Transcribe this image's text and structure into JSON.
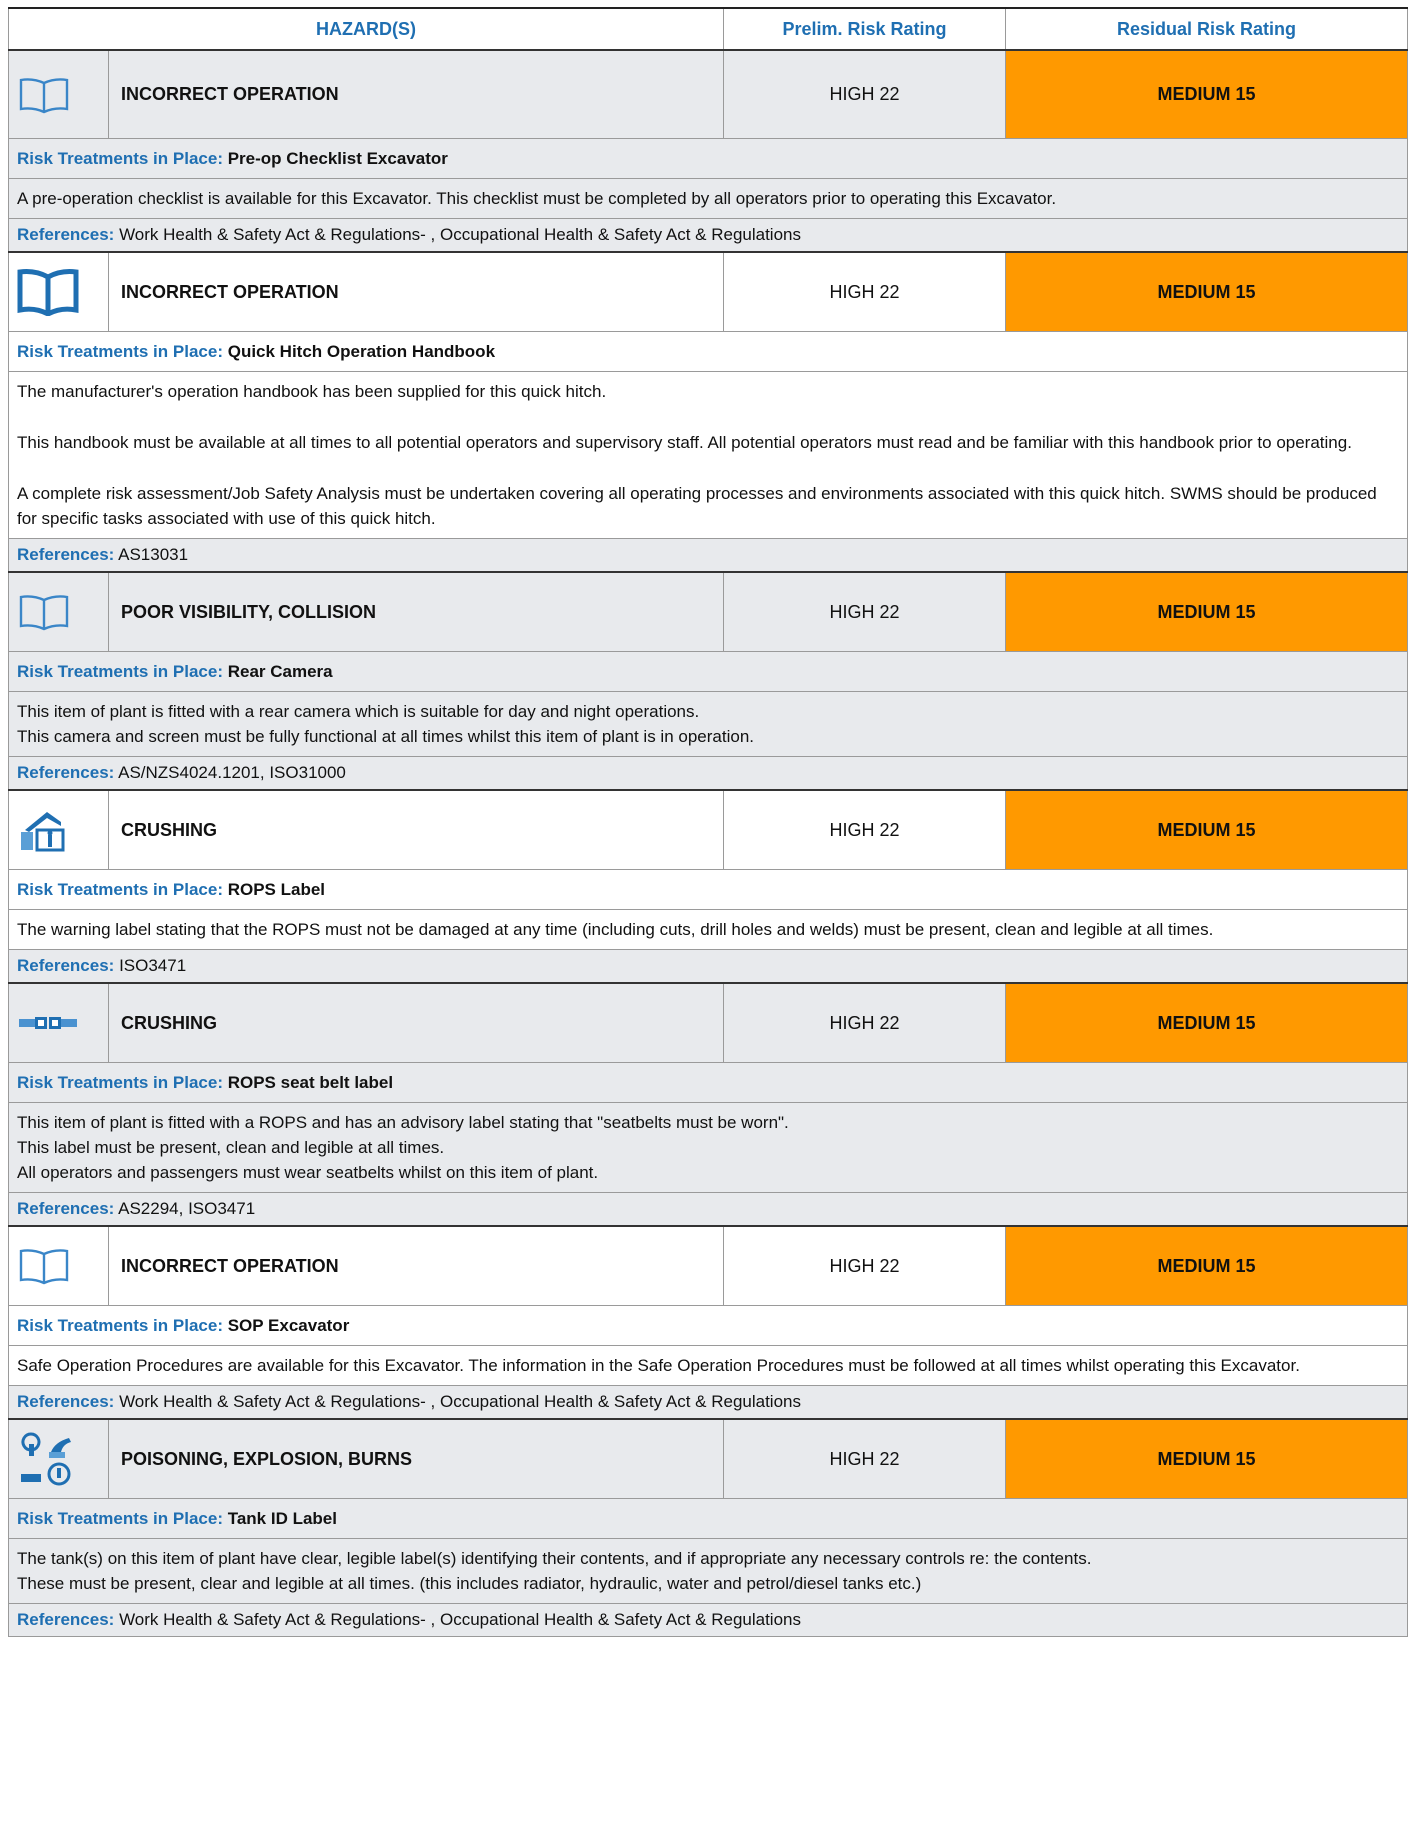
{
  "header": {
    "hazards": "HAZARD(S)",
    "prelim": "Prelim. Risk Rating",
    "residual": "Residual Risk Rating"
  },
  "labels": {
    "treatments": "Risk Treatments in Place:",
    "references": "References:"
  },
  "colors": {
    "accent": "#1f6fb2",
    "residual_bg": "#ff9900",
    "row_gray": "#e8eaed"
  },
  "rows": [
    {
      "icon": "book-outline-icon",
      "hazard": "INCORRECT OPERATION",
      "prelim": "HIGH 22",
      "residual": "MEDIUM 15",
      "treatment": "Pre-op Checklist Excavator",
      "description": [
        "A pre-operation checklist is available for this Excavator. This checklist must be completed by all operators prior to operating this Excavator."
      ],
      "references": "Work Health & Safety Act & Regulations- , Occupational Health & Safety Act & Regulations"
    },
    {
      "icon": "book-filled-icon",
      "hazard": "INCORRECT OPERATION",
      "prelim": "HIGH 22",
      "residual": "MEDIUM 15",
      "treatment": "Quick Hitch Operation Handbook",
      "description": [
        "The manufacturer's operation handbook has been supplied for this quick hitch.",
        "This handbook must be available at all times to all potential operators and supervisory staff. All potential operators must read and be familiar with this handbook prior to operating.",
        "A complete risk assessment/Job Safety Analysis must be undertaken covering all operating processes and environments associated with this quick hitch. SWMS should be produced for specific tasks associated with use of this quick hitch."
      ],
      "references": "AS13031"
    },
    {
      "icon": "book-outline-icon",
      "hazard": "POOR VISIBILITY, COLLISION",
      "prelim": "HIGH 22",
      "residual": "MEDIUM 15",
      "treatment": "Rear Camera",
      "description": [
        "This item of plant is fitted with a rear camera which is suitable for day and night operations.\nThis camera and screen must be fully functional at all times whilst this item of plant is in operation."
      ],
      "references": "AS/NZS4024.1201, ISO31000"
    },
    {
      "icon": "rops-label-icon",
      "hazard": "CRUSHING",
      "prelim": "HIGH 22",
      "residual": "MEDIUM 15",
      "treatment": "ROPS Label",
      "description": [
        "The warning label stating that the ROPS must not be damaged at any time (including cuts, drill holes and welds) must be present, clean and legible at all times."
      ],
      "references": "ISO3471"
    },
    {
      "icon": "seat-belt-icon",
      "hazard": "CRUSHING",
      "prelim": "HIGH 22",
      "residual": "MEDIUM 15",
      "treatment": "ROPS seat belt label",
      "description": [
        "This item of plant is fitted with a ROPS and has an advisory label stating that \"seatbelts must be worn\".\nThis label must be present, clean and legible at all times.\nAll operators and passengers must wear seatbelts whilst on this item of plant."
      ],
      "references": "AS2294, ISO3471"
    },
    {
      "icon": "book-outline-icon",
      "hazard": "INCORRECT OPERATION",
      "prelim": "HIGH 22",
      "residual": "MEDIUM 15",
      "treatment": "SOP Excavator",
      "description": [
        "Safe Operation Procedures are available for this Excavator. The information in the Safe Operation Procedures must be followed at all times whilst operating this Excavator."
      ],
      "references": "Work Health & Safety Act & Regulations- , Occupational Health & Safety Act & Regulations"
    },
    {
      "icon": "tank-label-icon",
      "hazard": "POISONING, EXPLOSION, BURNS",
      "prelim": "HIGH 22",
      "residual": "MEDIUM 15",
      "treatment": "Tank ID Label",
      "description": [
        "The tank(s) on this item of plant have clear, legible label(s) identifying their contents, and if appropriate any necessary controls re: the contents.\nThese must be present, clear and legible at all times. (this includes radiator, hydraulic, water and petrol/diesel tanks etc.)"
      ],
      "references": "Work Health & Safety Act & Regulations- , Occupational Health & Safety Act & Regulations"
    }
  ]
}
